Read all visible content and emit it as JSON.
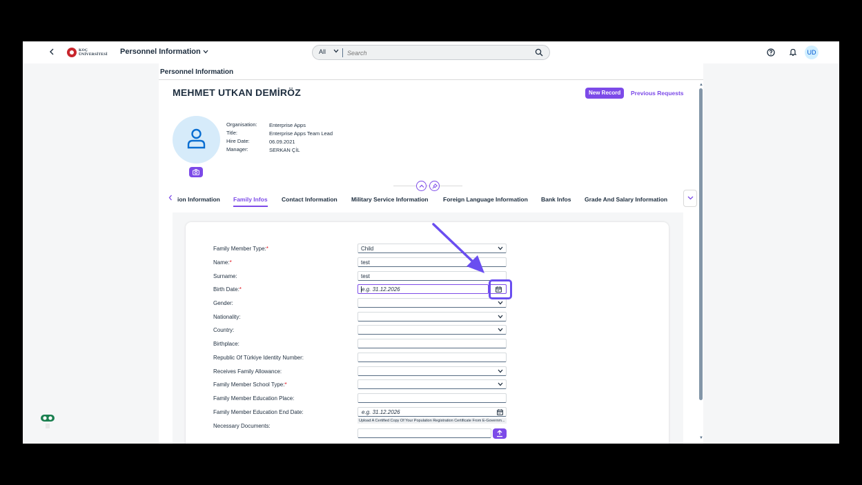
{
  "shell": {
    "back_icon": "chevron-left-icon",
    "logo_text_line1": "KOÇ",
    "logo_text_line2": "ÜNİVERSİTESİ",
    "app_title": "Personnel Information",
    "app_title_chevron": "⌄",
    "search": {
      "scope": "All",
      "placeholder": "Search"
    },
    "avatar_initials": "UD"
  },
  "page": {
    "title": "Personnel Information",
    "employee_name": "MEHMET UTKAN DEMİRÖZ",
    "buttons": {
      "new_record": "New Record",
      "previous_requests": "Previous Requests"
    },
    "info": [
      {
        "label": "Organisation:",
        "value": "Enterprise Apps"
      },
      {
        "label": "Title:",
        "value": "Enterprise Apps Team Lead"
      },
      {
        "label": "Hire Date:",
        "value": "06.09.2021"
      },
      {
        "label": "Manager:",
        "value": "SERKAN ÇİL"
      }
    ]
  },
  "tabs": {
    "items": [
      {
        "label": "ion Information",
        "active": false
      },
      {
        "label": "Family Infos",
        "active": true
      },
      {
        "label": "Contact Information",
        "active": false
      },
      {
        "label": "Military Service Information",
        "active": false
      },
      {
        "label": "Foreign Language Information",
        "active": false
      },
      {
        "label": "Bank Infos",
        "active": false
      },
      {
        "label": "Grade And Salary Information",
        "active": false
      }
    ]
  },
  "form": {
    "rows": [
      {
        "label": "Family Member Type:",
        "required": true,
        "type": "select",
        "value": "Child"
      },
      {
        "label": "Name:",
        "required": true,
        "type": "text",
        "value": "test"
      },
      {
        "label": "Surname:",
        "required": false,
        "type": "text",
        "value": "test"
      },
      {
        "label": "Birth Date:",
        "required": true,
        "type": "date",
        "placeholder": "e.g. 31.12.2026",
        "focused": true
      },
      {
        "label": "Gender:",
        "required": false,
        "type": "select",
        "value": ""
      },
      {
        "label": "Nationality:",
        "required": false,
        "type": "select",
        "value": ""
      },
      {
        "label": "Country:",
        "required": false,
        "type": "select",
        "value": ""
      },
      {
        "label": "Birthplace:",
        "required": false,
        "type": "text",
        "value": ""
      },
      {
        "label": "Republic Of Türkiye Identity Number:",
        "required": false,
        "type": "text",
        "value": ""
      },
      {
        "label": "Receives Family Allowance:",
        "required": false,
        "type": "select",
        "value": ""
      },
      {
        "label": "Family Member School Type:",
        "required": true,
        "type": "select",
        "value": ""
      },
      {
        "label": "Family Member Education Place:",
        "required": false,
        "type": "text",
        "value": ""
      },
      {
        "label": "Family Member Education End Date:",
        "required": false,
        "type": "date",
        "placeholder": "e.g. 31.12.2026"
      }
    ],
    "necessary_documents": {
      "label": "Necessary Documents:",
      "note": "Upload A Certified Copy Of Your Population Registration Certificate From E-Governm..."
    }
  },
  "colors": {
    "accent": "#7c4ae8",
    "annotation": "#6a4ef0",
    "required": "#e0101a"
  }
}
